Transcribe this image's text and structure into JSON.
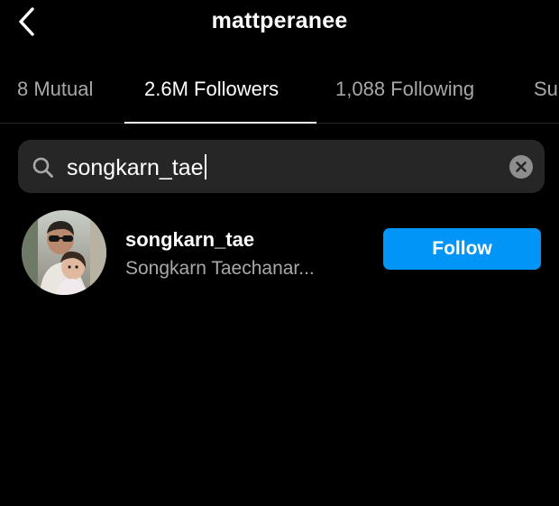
{
  "header": {
    "title": "mattperanee",
    "back_icon": "chevron-left-icon"
  },
  "tabs": [
    {
      "label": "8 Mutual",
      "active": false
    },
    {
      "label": "2.6M Followers",
      "active": true
    },
    {
      "label": "1,088 Following",
      "active": false
    },
    {
      "label": "Su",
      "active": false
    }
  ],
  "search": {
    "value": "songkarn_tae",
    "search_icon": "search-icon",
    "clear_icon": "clear-icon"
  },
  "results": [
    {
      "username": "songkarn_tae",
      "full_name": "Songkarn Taechanar...",
      "button_label": "Follow"
    }
  ],
  "colors": {
    "background": "#000000",
    "accent": "#0095f6",
    "muted_text": "#a8a8a8",
    "field": "#262626"
  }
}
